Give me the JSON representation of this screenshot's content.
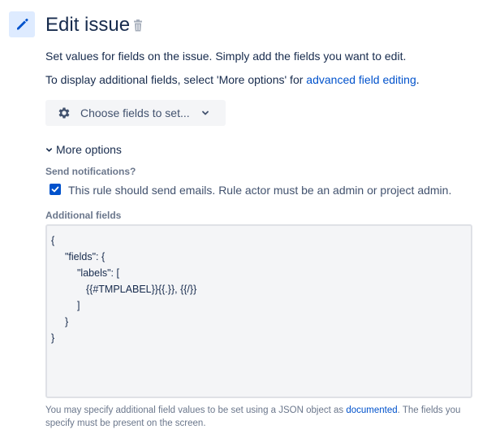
{
  "header": {
    "title": "Edit issue",
    "icon": "pencil-icon",
    "delete_icon": "trash-icon"
  },
  "description": {
    "line1": "Set values for fields on the issue. Simply add the fields you want to edit.",
    "line2_prefix": "To display additional fields, select 'More options' for ",
    "line2_link": "advanced field editing",
    "line2_suffix": "."
  },
  "choose_fields": {
    "label": "Choose fields to set...",
    "icon": "gear-icon"
  },
  "more_options": {
    "label": "More options",
    "expanded": true
  },
  "notifications": {
    "label": "Send notifications?",
    "checkbox_label": "This rule should send emails. Rule actor must be an admin or project admin.",
    "checked": true
  },
  "additional_fields": {
    "label": "Additional fields",
    "code_lines": [
      "{",
      "\"fields\": {",
      "\"labels\": [",
      "{{#TMPLABEL}}{{.}}, {{/}}",
      "]",
      "}",
      "}"
    ]
  },
  "help": {
    "prefix": "You may specify additional field values to be set using a JSON object as ",
    "link": "documented",
    "suffix": ". The fields you specify must be present on the screen."
  },
  "colors": {
    "accent": "#0052cc",
    "icon_bg": "#deebff",
    "text": "#172b4d",
    "muted": "#6b778c"
  }
}
